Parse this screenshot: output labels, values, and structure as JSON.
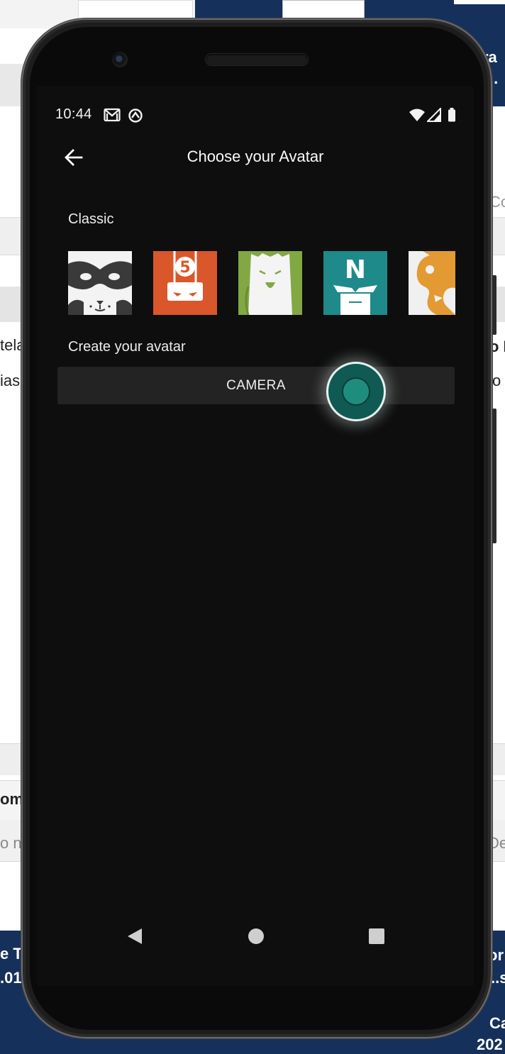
{
  "status_bar": {
    "time": "10:44",
    "icons": [
      "gmail-icon",
      "sync-icon",
      "wifi-icon",
      "cell-signal-icon",
      "battery-icon"
    ]
  },
  "app_bar": {
    "title": "Choose your Avatar",
    "back_icon": "arrow-back-icon"
  },
  "sections": {
    "classic_label": "Classic",
    "create_label": "Create your avatar"
  },
  "avatars": [
    {
      "name": "raccoon-mask",
      "bg": "#f3f3f3",
      "fg": "#3a3a3a"
    },
    {
      "name": "orange-number-five",
      "bg": "#d9572a",
      "fg": "#ffffff"
    },
    {
      "name": "green-smile",
      "bg": "#82a843",
      "fg": "#f6f6f6"
    },
    {
      "name": "teal-letter-n",
      "bg": "#1e8a8a",
      "fg": "#ffffff"
    },
    {
      "name": "orange-partial",
      "bg": "#f0f0f0",
      "fg": "#e39a32"
    }
  ],
  "camera_button": {
    "label": "CAMERA"
  },
  "touch_indicator_color": "#1f8d7e",
  "nav_bar": {
    "icons": [
      "back-triangle-icon",
      "home-circle-icon",
      "recents-square-icon"
    ]
  },
  "background": {
    "left_texts": [
      "tela",
      "ias",
      "om",
      "o n",
      "e T",
      ".01"
    ],
    "right_texts": [
      "ra",
      "..",
      "Co",
      "o I",
      "o",
      "De",
      "or",
      "..s",
      "Ca",
      "202"
    ]
  }
}
